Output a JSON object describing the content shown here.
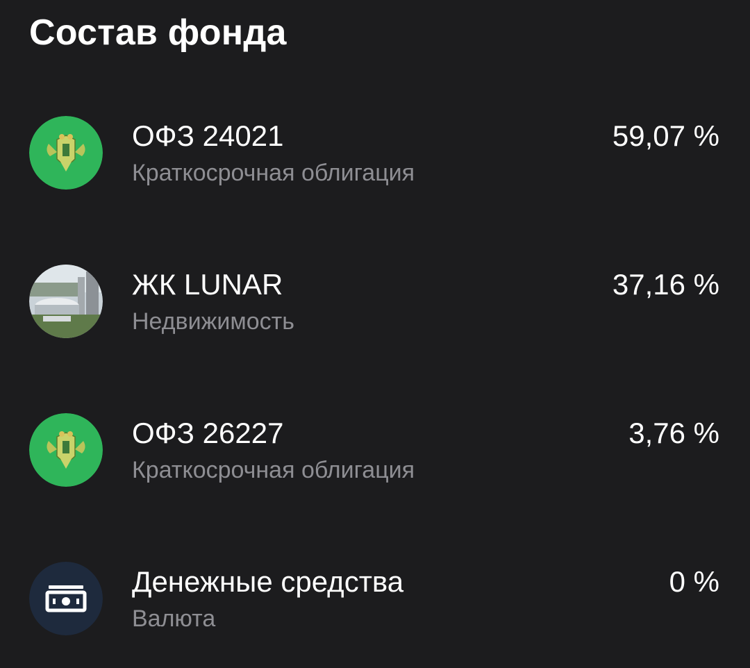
{
  "page": {
    "title": "Состав фонда"
  },
  "colors": {
    "background": "#1c1c1e",
    "primary_text": "#ffffff",
    "secondary_text": "#8e8e93",
    "bond_icon_bg": "#2fb55a",
    "cash_icon_bg": "#1e2a3d"
  },
  "holdings": [
    {
      "name": "ОФЗ 24021",
      "type": "Краткосрочная облигация",
      "share": "59,07 %",
      "icon": "coat-of-arms-icon"
    },
    {
      "name": "ЖК LUNAR",
      "type": "Недвижимость",
      "share": "37,16 %",
      "icon": "city-photo-icon"
    },
    {
      "name": "ОФЗ 26227",
      "type": "Краткосрочная облигация",
      "share": "3,76 %",
      "icon": "coat-of-arms-icon"
    },
    {
      "name": "Денежные средства",
      "type": "Валюта",
      "share": "0 %",
      "icon": "banknote-icon"
    }
  ]
}
